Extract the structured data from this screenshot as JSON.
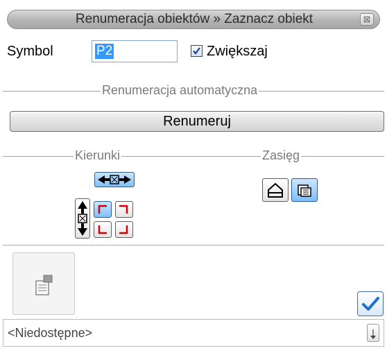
{
  "window": {
    "title": "Renumeracja obiektów » Zaznacz obiekt",
    "close_glyph": "⊠"
  },
  "symbol": {
    "label": "Symbol",
    "value": "P2"
  },
  "increase": {
    "label": "Zwiększaj",
    "checked": true
  },
  "auto_group": {
    "label": "Renumeracja automatyczna"
  },
  "renumber_button": {
    "label": "Renumeruj"
  },
  "directions": {
    "label": "Kierunki",
    "horizontal": {
      "icon": "horizontal-arrows-icon",
      "selected": true
    },
    "vertical": {
      "icon": "vertical-arrows-icon",
      "selected": false
    },
    "corners": [
      {
        "icon": "corner-top-left-icon",
        "selected": true
      },
      {
        "icon": "corner-top-right-icon",
        "selected": false
      },
      {
        "icon": "corner-bottom-left-icon",
        "selected": false
      },
      {
        "icon": "corner-bottom-right-icon",
        "selected": false
      }
    ]
  },
  "scope": {
    "label": "Zasięg",
    "options": [
      {
        "icon": "house-icon",
        "selected": false
      },
      {
        "icon": "layers-icon",
        "selected": true
      }
    ]
  },
  "properties_button": {
    "icon": "properties-icon"
  },
  "ok_button": {
    "icon": "checkmark-icon"
  },
  "status": {
    "text": "<Niedostępne>"
  },
  "colors": {
    "accent": "#3399ff",
    "selected_fill": "#7fc0f6",
    "corner_mark": "#d00000",
    "check": "#1e6fd0"
  }
}
